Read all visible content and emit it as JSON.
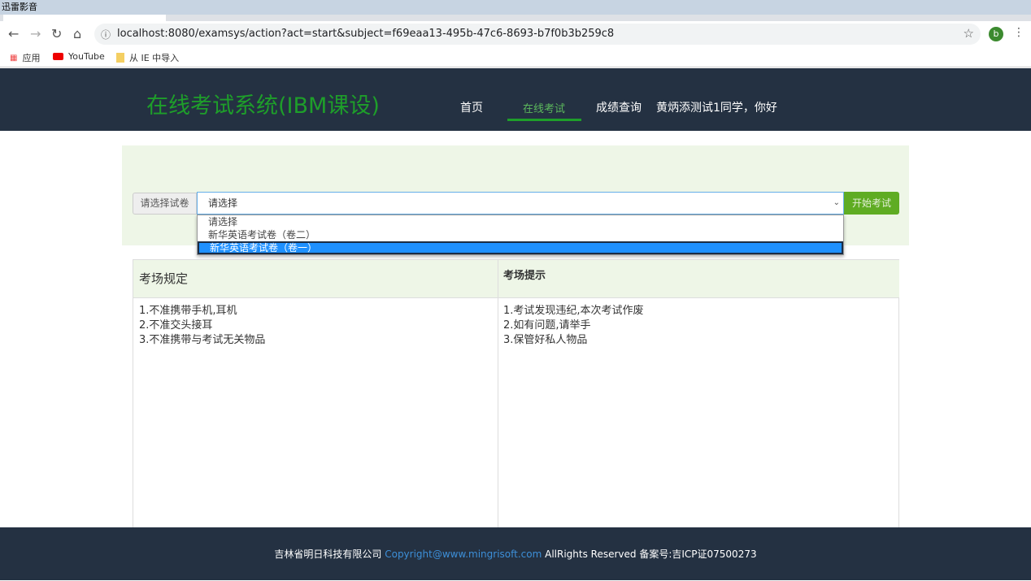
{
  "os": {
    "title": "迅雷影音"
  },
  "browser": {
    "url": "localhost:8080/examsys/action?act=start&subject=f69eaa13-495b-47c6-8693-b7f0b3b259c8",
    "profile_initial": "b",
    "bookmarks": [
      {
        "label": "应用"
      },
      {
        "label": "YouTube"
      },
      {
        "label": "从 IE 中导入"
      }
    ]
  },
  "header": {
    "brand": "在线考试系统(IBM课设)",
    "nav": [
      {
        "label": "首页"
      },
      {
        "label": "在线考试"
      },
      {
        "label": "成绩查询"
      }
    ],
    "greeting": "黄炳添测试1同学，你好"
  },
  "exam_select": {
    "label": "请选择试卷",
    "selected": "请选择",
    "options": [
      "请选择",
      "新华英语考试卷（卷二）",
      "新华英语考试卷（卷一）"
    ],
    "start_button": "开始考试"
  },
  "rules": {
    "title": "考场规定",
    "items": [
      "1.不准携带手机,耳机",
      "2.不准交头接耳",
      "3.不准携带与考试无关物品"
    ]
  },
  "tips": {
    "title": "考场提示",
    "items": [
      "1.考试发现违纪,本次考试作废",
      "2.如有问题,请举手",
      "3.保管好私人物品"
    ]
  },
  "footer": {
    "company": "吉林省明日科技有限公司",
    "copyright": "Copyright@www.mingrisoft.com",
    "rest": "AllRights Reserved 备案号:吉ICP证07500273"
  }
}
